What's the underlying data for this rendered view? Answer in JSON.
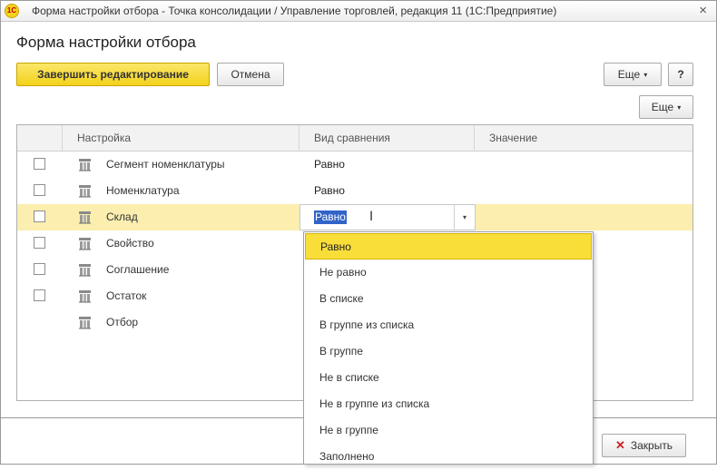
{
  "window": {
    "title": "Форма настройки отбора - Точка консолидации / Управление торговлей, редакция 11  (1С:Предприятие)",
    "close_glyph": "×",
    "app_icon_text": "1С"
  },
  "form": {
    "title": "Форма настройки отбора"
  },
  "toolbar": {
    "finish_label": "Завершить редактирование",
    "cancel_label": "Отмена",
    "more_label": "Еще",
    "help_label": "?",
    "more2_label": "Еще",
    "caret": "▾"
  },
  "table": {
    "columns": [
      "",
      "Настройка",
      "Вид сравнения",
      "Значение"
    ],
    "rows": [
      {
        "name": "Сегмент номенклатуры",
        "comparison": "Равно",
        "checkbox": true
      },
      {
        "name": "Номенклатура",
        "comparison": "Равно",
        "checkbox": true
      },
      {
        "name": "Склад",
        "comparison": "Равно",
        "checkbox": true,
        "selected": true,
        "editing": true
      },
      {
        "name": "Свойство",
        "comparison": "",
        "checkbox": true
      },
      {
        "name": "Соглашение",
        "comparison": "",
        "checkbox": true
      },
      {
        "name": "Остаток",
        "comparison": "",
        "checkbox": true
      },
      {
        "name": "Отбор",
        "comparison": "",
        "checkbox": false
      }
    ]
  },
  "editor": {
    "value": "Равно",
    "ibeam": "I",
    "dropdown_glyph": "▾"
  },
  "dropdown": {
    "options": [
      "Равно",
      "Не равно",
      "В списке",
      "В группе из списка",
      "В группе",
      "Не в списке",
      "Не в группе из списка",
      "Не в группе",
      "Заполнено"
    ],
    "highlighted": "Равно"
  },
  "footer": {
    "close_label": "Закрыть",
    "close_glyph": "✕"
  },
  "colors": {
    "accent_yellow": "#f3d21b",
    "row_selected": "#fbeeaf",
    "selection_blue": "#3264c8",
    "close_red": "#d02020"
  }
}
